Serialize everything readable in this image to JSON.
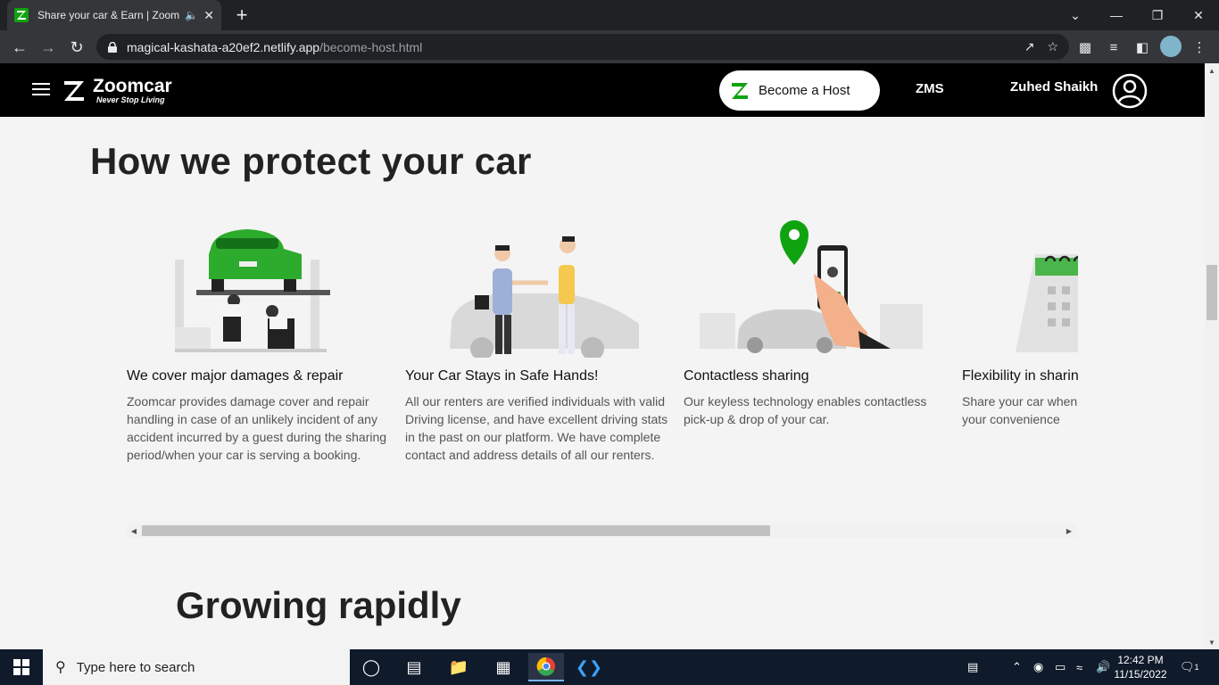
{
  "browser": {
    "tab_title": "Share your car & Earn | Zoomcar",
    "url_host": "magical-kashata-a20ef2.netlify.app",
    "url_path": "/become-host.html"
  },
  "header": {
    "brand_name": "Zoomcar",
    "brand_tagline": "Never Stop Living",
    "become_host": "Become a Host",
    "zms": "ZMS",
    "user_name": "Zuhed Shaikh"
  },
  "main": {
    "section_title": "How we protect your car",
    "cards": [
      {
        "title": "We cover major damages & repair",
        "description": "Zoomcar provides damage cover and repair handling in case of an unlikely incident of any accident incurred by a guest during the sharing period/when your car is serving a booking."
      },
      {
        "title": "Your Car Stays in Safe Hands!",
        "description": "All our renters are verified individuals with valid Driving license, and have excellent driving stats in the past on our platform. We have complete contact and address details of all our renters."
      },
      {
        "title": "Contactless sharing",
        "description": "Our keyless technology enables contactless pick-up & drop of your car."
      },
      {
        "title": "Flexibility in sharing",
        "description": "Share your car when not in your usage, as per your convenience"
      }
    ],
    "next_section_title": "Growing rapidly"
  },
  "taskbar": {
    "search_placeholder": "Type here to search",
    "time": "12:42 PM",
    "date": "11/15/2022",
    "notification_count": "1"
  },
  "colors": {
    "brand_green": "#10a310",
    "header_bg": "#000000",
    "page_bg": "#f4f4f4"
  }
}
